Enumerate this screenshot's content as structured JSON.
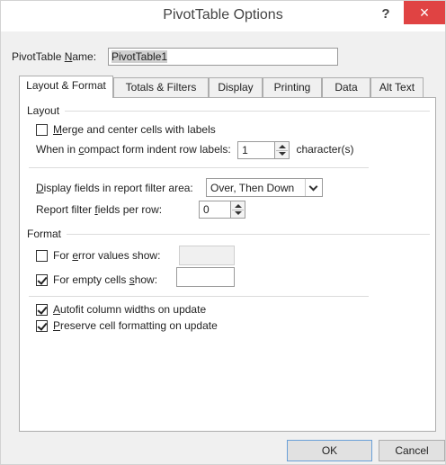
{
  "window": {
    "title": "PivotTable Options",
    "help": "?",
    "close": "×"
  },
  "name": {
    "label_pre": "PivotTable ",
    "label_ul": "N",
    "label_post": "ame:",
    "value": "PivotTable1"
  },
  "tabs": [
    "Layout & Format",
    "Totals & Filters",
    "Display",
    "Printing",
    "Data",
    "Alt Text"
  ],
  "layout": {
    "section": "Layout",
    "merge": {
      "ul": "M",
      "rest": "erge and center cells with labels",
      "checked": false
    },
    "indent": {
      "pre": "When in ",
      "ul": "c",
      "post": "ompact form indent row labels:",
      "value": "1",
      "suffix": "character(s)"
    },
    "display_fields": {
      "ul": "D",
      "rest": "isplay fields in report filter area:",
      "value": "Over, Then Down"
    },
    "report_filter": {
      "pre": "Report filter ",
      "ul": "f",
      "post": "ields per row:",
      "value": "0"
    }
  },
  "format": {
    "section": "Format",
    "error": {
      "pre": "For ",
      "ul": "e",
      "post": "rror values show:",
      "checked": false
    },
    "empty": {
      "pre": "For empty cells ",
      "ul": "s",
      "post": "how:",
      "checked": true
    },
    "autofit": {
      "ul": "A",
      "rest": "utofit column widths on update",
      "checked": true
    },
    "preserve": {
      "ul": "P",
      "rest": "reserve cell formatting on update",
      "checked": true
    }
  },
  "buttons": {
    "ok": "OK",
    "cancel": "Cancel"
  },
  "colors": {
    "close": "#e04343",
    "window_bg": "#f0f0f0"
  }
}
